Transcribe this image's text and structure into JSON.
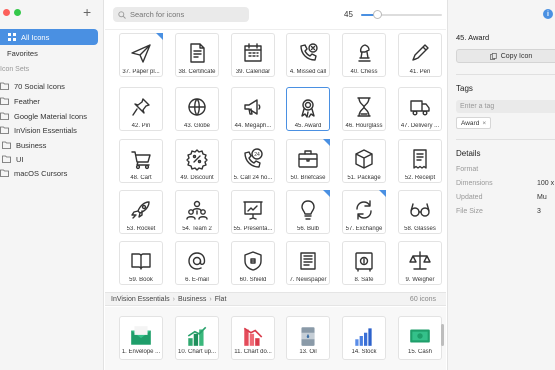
{
  "colors": {
    "accent": "#4a90e2",
    "sidebar_bg": "#f5f5f5",
    "window_dot_red": "#fc605b",
    "window_dot_green": "#34c84a"
  },
  "sidebar": {
    "add_label": "+",
    "all_icons": "All Icons",
    "favorites": "Favorites",
    "section_title": "Icon Sets",
    "sets": [
      "70 Social Icons",
      "Feather",
      "Google Material Icons",
      "InVision Essentials"
    ],
    "subsets": [
      "Business",
      "UI"
    ],
    "extra": "macOS Cursors"
  },
  "toolbar": {
    "search_placeholder": "Search for icons",
    "size_value": "45",
    "size_fraction": 0.2
  },
  "grid": {
    "icons": [
      {
        "label": "37. Paper pl...",
        "icon": "paper-plane-icon",
        "badge": true
      },
      {
        "label": "38. Certificate",
        "icon": "certificate-icon",
        "badge": false
      },
      {
        "label": "39. Calendar",
        "icon": "calendar-icon",
        "badge": false
      },
      {
        "label": "4. Missed call",
        "icon": "missed-call-icon",
        "badge": false
      },
      {
        "label": "40. Chess",
        "icon": "chess-icon",
        "badge": false
      },
      {
        "label": "41. Pen",
        "icon": "pen-icon",
        "badge": false
      },
      {
        "label": "42. Pin",
        "icon": "pin-icon",
        "badge": false
      },
      {
        "label": "43. Globe",
        "icon": "globe-icon",
        "badge": false
      },
      {
        "label": "44. Megaph...",
        "icon": "megaphone-icon",
        "badge": false
      },
      {
        "label": "45. Award",
        "icon": "award-icon",
        "badge": false,
        "selected": true
      },
      {
        "label": "46. Hourglass",
        "icon": "hourglass-icon",
        "badge": false
      },
      {
        "label": "47. Delivery ...",
        "icon": "delivery-truck-icon",
        "badge": false
      },
      {
        "label": "48. Cart",
        "icon": "cart-icon",
        "badge": false
      },
      {
        "label": "49. Discount",
        "icon": "discount-icon",
        "badge": false
      },
      {
        "label": "5. Call 24 ho...",
        "icon": "call-24-icon",
        "badge": false
      },
      {
        "label": "50. Briefcase",
        "icon": "briefcase-icon",
        "badge": true
      },
      {
        "label": "51. Package",
        "icon": "package-icon",
        "badge": false
      },
      {
        "label": "52. Receipt",
        "icon": "receipt-icon",
        "badge": false
      },
      {
        "label": "53. Rocket",
        "icon": "rocket-icon",
        "badge": false
      },
      {
        "label": "54. Team 2",
        "icon": "team-icon",
        "badge": false
      },
      {
        "label": "55. Presenta...",
        "icon": "presentation-icon",
        "badge": false
      },
      {
        "label": "56. Bulb",
        "icon": "bulb-icon",
        "badge": true
      },
      {
        "label": "57. Exchange",
        "icon": "exchange-icon",
        "badge": true
      },
      {
        "label": "58. Glasses",
        "icon": "glasses-icon",
        "badge": false
      },
      {
        "label": "59. Book",
        "icon": "book-icon",
        "badge": false
      },
      {
        "label": "6. E-mail",
        "icon": "at-sign-icon",
        "badge": false
      },
      {
        "label": "60. Shield",
        "icon": "shield-icon",
        "badge": false
      },
      {
        "label": "7. Newspaper",
        "icon": "newspaper-icon",
        "badge": false
      },
      {
        "label": "8. Safe",
        "icon": "safe-icon",
        "badge": false
      },
      {
        "label": "9. Weigher",
        "icon": "scales-icon",
        "badge": false
      }
    ]
  },
  "set_bar": {
    "crumbs": [
      "InVision Essentials",
      "Business",
      "Flat"
    ],
    "count": "60 icons"
  },
  "flat_icons": [
    {
      "label": "1. Envelope ...",
      "icon": "envelope-flat-icon"
    },
    {
      "label": "10. Chart up...",
      "icon": "chart-up-flat-icon"
    },
    {
      "label": "11. Chart do...",
      "icon": "chart-down-flat-icon"
    },
    {
      "label": "13. Oil",
      "icon": "oil-flat-icon"
    },
    {
      "label": "14. Stock",
      "icon": "stock-flat-icon"
    },
    {
      "label": "15. Cash",
      "icon": "cash-flat-icon"
    }
  ],
  "panel": {
    "title": "45. Award",
    "copy_label": "Copy Icon",
    "tags_title": "Tags",
    "tag_placeholder": "Enter a tag",
    "tags": [
      "Award"
    ],
    "details_title": "Details",
    "details": [
      {
        "key": "Format",
        "value": ""
      },
      {
        "key": "Dimensions",
        "value": "100 x"
      },
      {
        "key": "Updated",
        "value": "Mu"
      },
      {
        "key": "File Size",
        "value": "3"
      }
    ]
  }
}
